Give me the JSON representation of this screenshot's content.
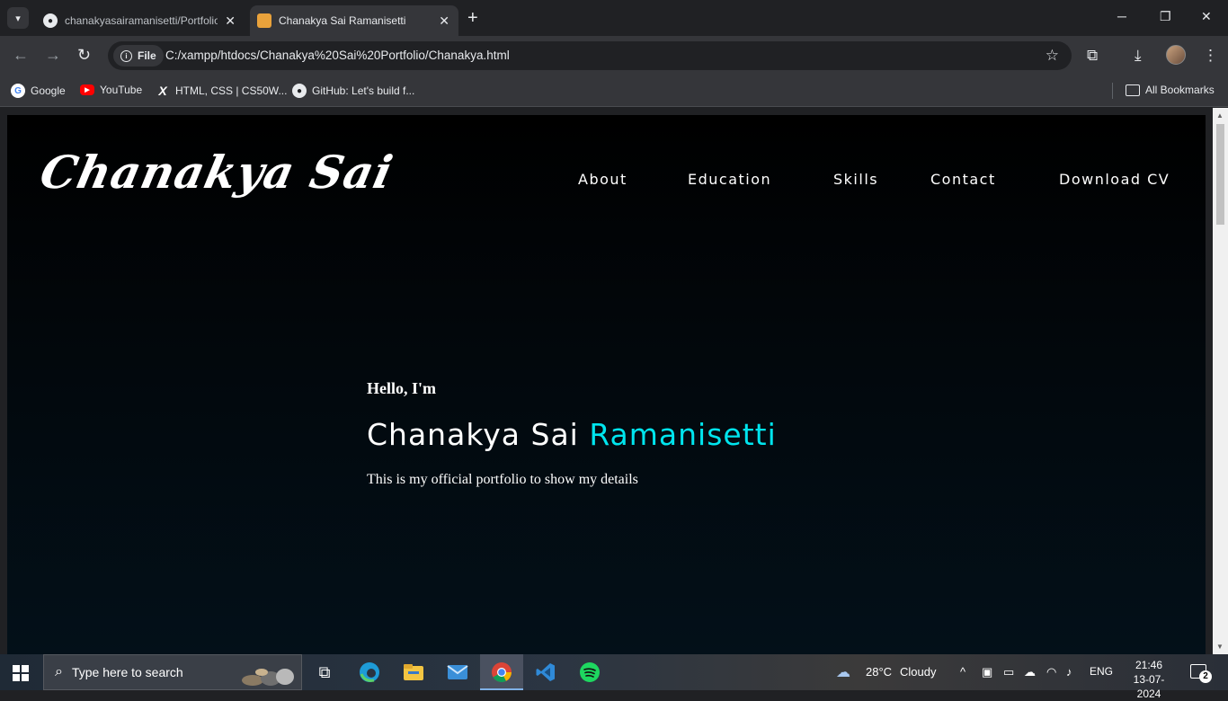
{
  "browser": {
    "tabs": [
      {
        "title": "chanakyasairamanisetti/Portfolio",
        "favicon": "github-icon"
      },
      {
        "title": "Chanakya Sai Ramanisetti",
        "favicon": "portfolio-icon"
      }
    ],
    "address": {
      "chip": "File",
      "url": "C:/xampp/htdocs/Chanakya%20Sai%20Portfolio/Chanakya.html"
    },
    "bookmarks": [
      {
        "label": "Google",
        "icon": "google-icon"
      },
      {
        "label": "YouTube",
        "icon": "youtube-icon"
      },
      {
        "label": "HTML, CSS | CS50W...",
        "icon": "x-icon"
      },
      {
        "label": "GitHub: Let's build f...",
        "icon": "github-icon"
      }
    ],
    "all_bookmarks": "All Bookmarks"
  },
  "page": {
    "logo": "Chanakya Sai",
    "nav": [
      "About",
      "Education",
      "Skills",
      "Contact",
      "Download CV"
    ],
    "hero": {
      "greeting": "Hello, I'm",
      "name_first": "Chanakya Sai",
      "name_last": "Ramanisetti",
      "tagline": "This is my official portfolio to show my details"
    },
    "accent_color": "#00e5ee"
  },
  "taskbar": {
    "search_placeholder": "Type here to search",
    "weather": {
      "temp": "28°C",
      "condition": "Cloudy"
    },
    "language": "ENG",
    "time": "21:46",
    "date": "13-07-2024",
    "notification_count": "2"
  }
}
